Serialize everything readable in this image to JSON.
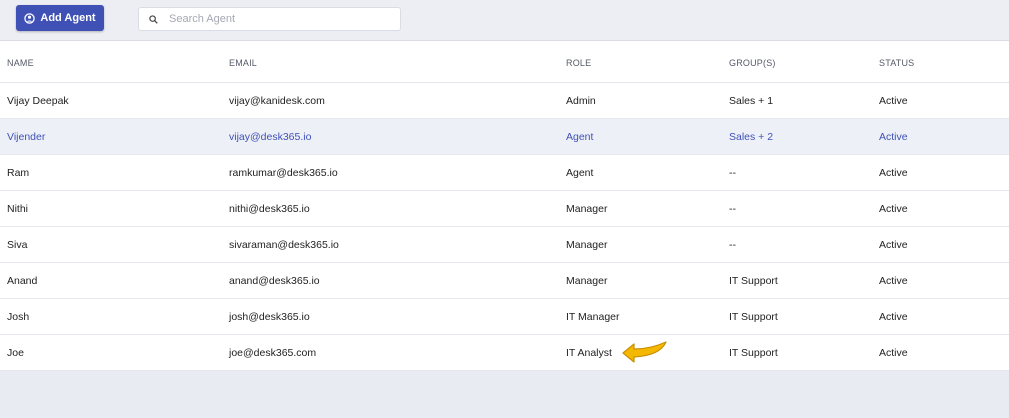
{
  "toolbar": {
    "add_agent_label": "Add Agent",
    "search_placeholder": "Search Agent",
    "accent_color": "#3f51b5"
  },
  "table": {
    "headers": {
      "name": "NAME",
      "email": "EMAIL",
      "role": "ROLE",
      "groups": "GROUP(S)",
      "status": "STATUS"
    },
    "rows": [
      {
        "name": "Vijay Deepak",
        "email": "vijay@kanidesk.com",
        "role": "Admin",
        "groups": "Sales + 1",
        "status": "Active"
      },
      {
        "name": "Vijender",
        "email": "vijay@desk365.io",
        "role": "Agent",
        "groups": "Sales + 2",
        "status": "Active",
        "highlighted": true
      },
      {
        "name": "Ram",
        "email": "ramkumar@desk365.io",
        "role": "Agent",
        "groups": "--",
        "status": "Active"
      },
      {
        "name": "Nithi",
        "email": "nithi@desk365.io",
        "role": "Manager",
        "groups": "--",
        "status": "Active"
      },
      {
        "name": "Siva",
        "email": "sivaraman@desk365.io",
        "role": "Manager",
        "groups": "--",
        "status": "Active"
      },
      {
        "name": "Anand",
        "email": "anand@desk365.io",
        "role": "Manager",
        "groups": "IT Support",
        "status": "Active"
      },
      {
        "name": "Josh",
        "email": "josh@desk365.io",
        "role": "IT Manager",
        "groups": "IT Support",
        "status": "Active"
      },
      {
        "name": "Joe",
        "email": "joe@desk365.com",
        "role": "IT Analyst",
        "groups": "IT Support",
        "status": "Active"
      }
    ]
  },
  "annotation": {
    "icon": "pointer-arrow-icon",
    "color": "#f5b800"
  }
}
